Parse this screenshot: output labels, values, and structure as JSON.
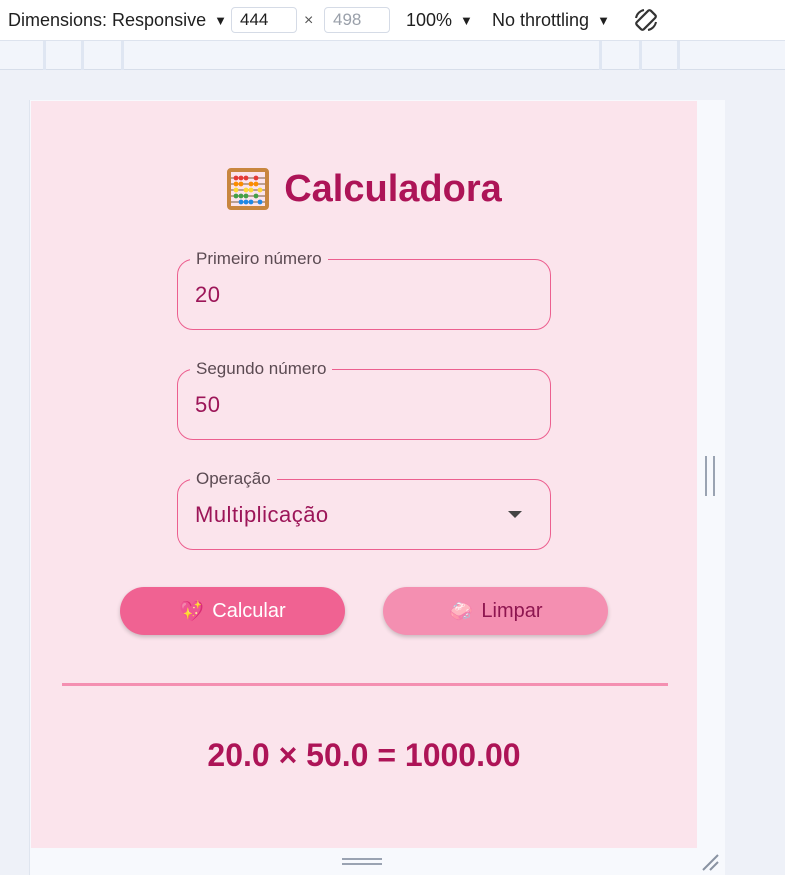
{
  "devtools": {
    "dimensions_label": "Dimensions: Responsive",
    "width": "444",
    "times": "×",
    "height": "498",
    "zoom": "100%",
    "throttling": "No throttling",
    "rotate_icon": "rotate-icon",
    "caret_icon": "▼"
  },
  "app": {
    "title": "Calculadora",
    "title_icon": "abacus-icon",
    "first": {
      "label": "Primeiro número",
      "value": "20"
    },
    "second": {
      "label": "Segundo número",
      "value": "50"
    },
    "operation": {
      "label": "Operação",
      "value": "Multiplicação"
    },
    "buttons": {
      "calculate": {
        "emoji": "💖",
        "label": "Calcular"
      },
      "clear": {
        "emoji": "🧼",
        "label": "Limpar"
      }
    },
    "result": "20.0 × 50.0 = 1000.00"
  },
  "colors": {
    "background": "#fbe4ec",
    "accent": "#ad1457",
    "field_border": "#ec5f8f",
    "button_primary": "#f06292",
    "button_secondary": "#f48fb1"
  }
}
